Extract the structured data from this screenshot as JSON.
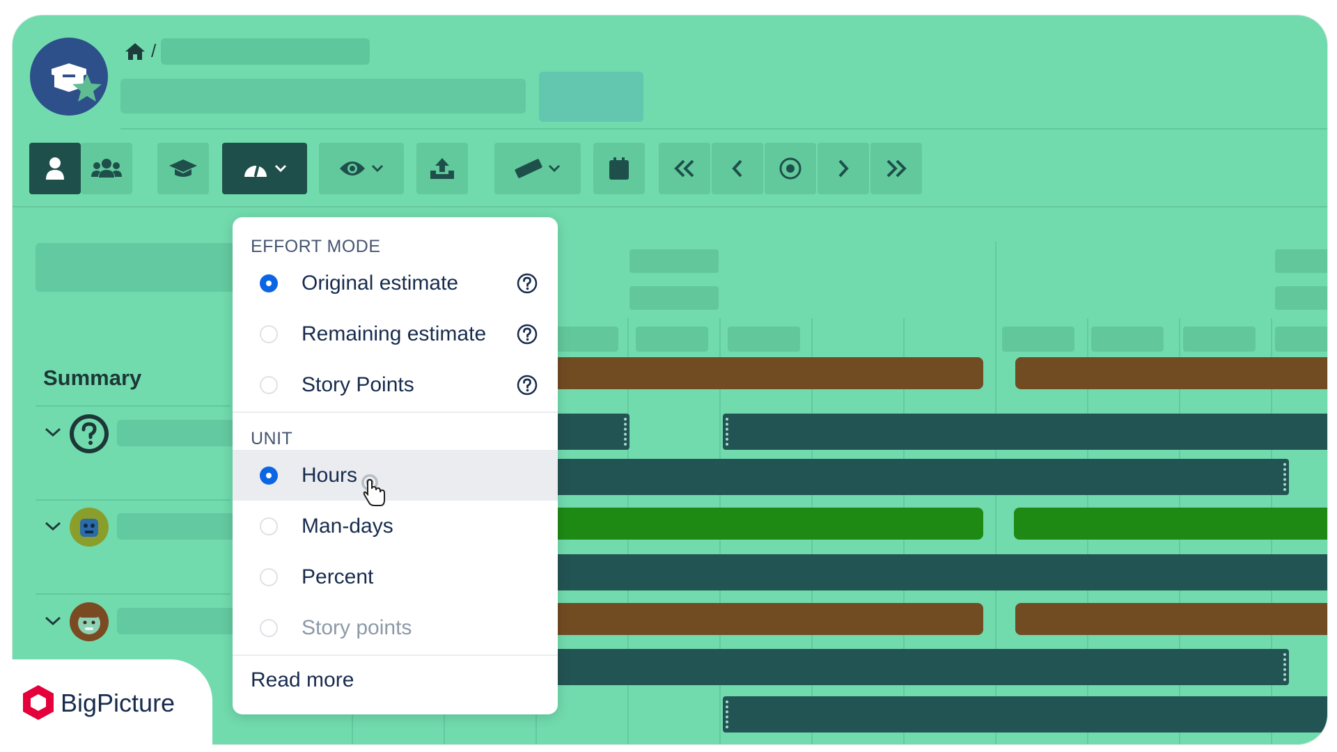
{
  "dropdown": {
    "effort_section": "EFFORT MODE",
    "effort_items": [
      {
        "label": "Original estimate",
        "checked": true,
        "help": true
      },
      {
        "label": "Remaining estimate",
        "checked": false,
        "help": true
      },
      {
        "label": "Story Points",
        "checked": false,
        "help": true
      }
    ],
    "unit_section": "UNIT",
    "unit_items": [
      {
        "label": "Hours",
        "checked": true,
        "hovered": true,
        "disabled": false
      },
      {
        "label": "Man-days",
        "checked": false,
        "disabled": false
      },
      {
        "label": "Percent",
        "checked": false,
        "disabled": false
      },
      {
        "label": "Story points",
        "checked": false,
        "disabled": true
      }
    ],
    "read_more": "Read more"
  },
  "sidebar": {
    "summary_label": "Summary"
  },
  "breadcrumb": {
    "separator": "/"
  },
  "brand": {
    "name": "BigPicture",
    "color": "#e4003a"
  },
  "colors": {
    "background": "#71dbae",
    "bar_brown": "#714b22",
    "bar_dark": "#225453",
    "bar_green": "#1e8a14",
    "accent": "#0c66e4"
  },
  "toolbar": {
    "icons": [
      "single-user-icon",
      "team-icon",
      "graduation-cap-icon",
      "gauge-icon",
      "eye-icon",
      "upload-icon",
      "ruler-icon",
      "calendar-icon",
      "double-chevron-left-icon",
      "chevron-left-icon",
      "target-icon",
      "chevron-right-icon",
      "double-chevron-right-icon"
    ]
  }
}
